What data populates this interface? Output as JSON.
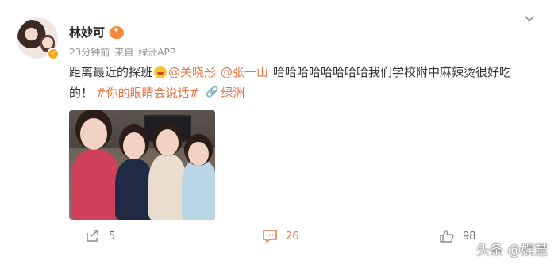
{
  "post": {
    "author": "林妙可",
    "meta": {
      "time": "23分钟前",
      "source_prefix": "来自",
      "source": "绿洲APP"
    },
    "text": {
      "segment1": "距离最近的探班",
      "mention1": "@关晓彤",
      "mention2": "@张一山",
      "segment2": "哈哈哈哈哈哈哈哈我们学校附中麻辣烫很好吃",
      "segment3": "的！",
      "topic": "#你的眼睛会说话#",
      "place": "绿洲"
    },
    "actions": {
      "repost_count": "5",
      "comment_count": "26",
      "like_count": "98"
    }
  },
  "watermark": "头条 @娱慧",
  "colors": {
    "accent": "#eb7340",
    "meta": "#939393",
    "verified": "#f5a623"
  },
  "icons": [
    "verified-icon",
    "vip-badge-icon",
    "chevron-down-icon",
    "laugh-emoji-icon",
    "link-icon",
    "repost-icon",
    "comment-icon",
    "like-icon"
  ]
}
